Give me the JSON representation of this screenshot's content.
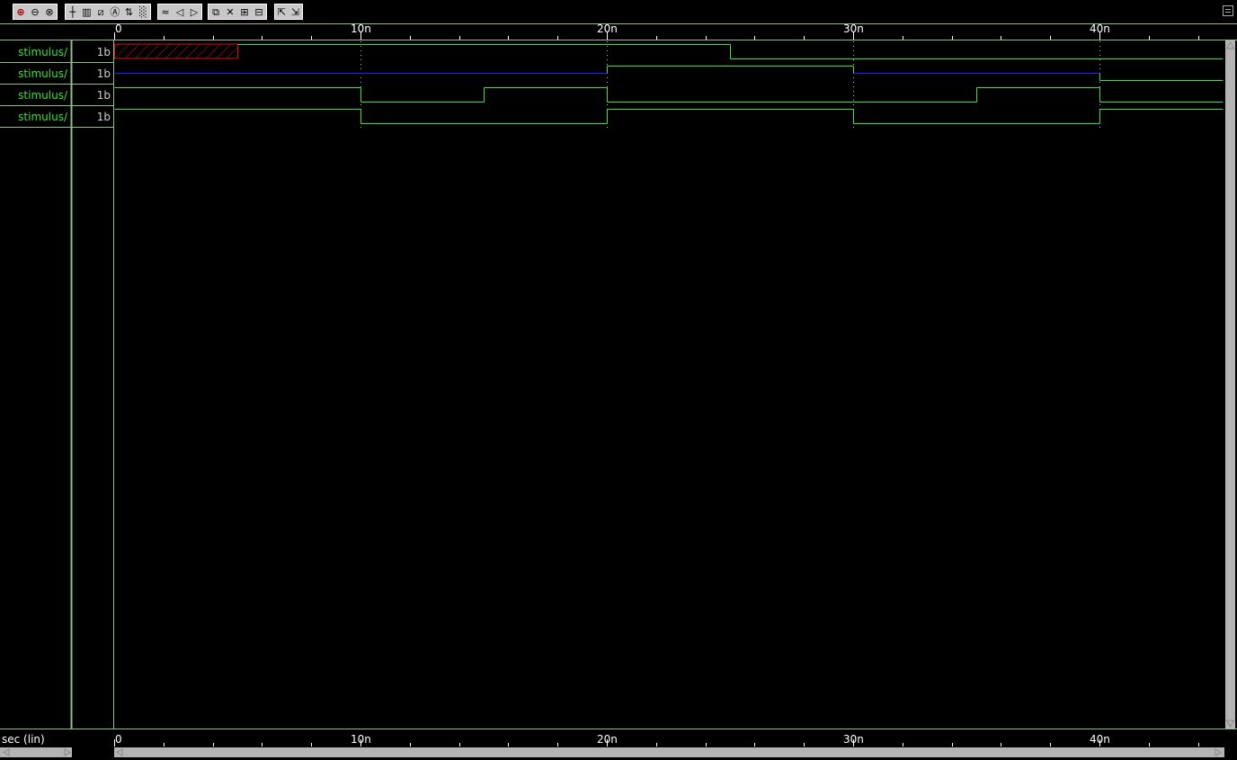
{
  "toolbar": {
    "groups": [
      {
        "name": "zoom",
        "icons": [
          "zoom-in-icon",
          "zoom-out-icon",
          "zoom-fit-icon"
        ]
      },
      {
        "name": "cursor",
        "icons": [
          "cursor-icon",
          "grid-lines-icon",
          "measure-icon",
          "annotate-icon",
          "marker-icon",
          "dots-grid-icon"
        ]
      },
      {
        "name": "navigate",
        "icons": [
          "wave-icon",
          "prev-edge-icon",
          "next-edge-icon"
        ]
      },
      {
        "name": "edit",
        "icons": [
          "copy-icon",
          "delete-icon",
          "group-icon",
          "ungroup-icon"
        ]
      },
      {
        "name": "view",
        "icons": [
          "expand-icon",
          "collapse-icon"
        ]
      }
    ]
  },
  "signals": [
    {
      "name": "stimulus/",
      "width": "1b"
    },
    {
      "name": "stimulus/",
      "width": "1b"
    },
    {
      "name": "stimulus/",
      "width": "1b"
    },
    {
      "name": "stimulus/",
      "width": "1b"
    }
  ],
  "timeline": {
    "unit_label": "sec (lin)",
    "top_ticks": [
      "0",
      "10n",
      "20n",
      "30n",
      "40n"
    ],
    "bottom_ticks": [
      "0",
      "10n",
      "20n",
      "30n",
      "40n"
    ]
  },
  "waveforms": [
    {
      "segments": [
        {
          "t0": 0,
          "t1": 5,
          "state": "X"
        },
        {
          "t0": 5,
          "t1": 25,
          "state": "1"
        },
        {
          "t0": 25,
          "t1": 45,
          "state": "0"
        }
      ]
    },
    {
      "segments": [
        {
          "t0": 0,
          "t1": 20,
          "state": "Z"
        },
        {
          "t0": 20,
          "t1": 30,
          "state": "1"
        },
        {
          "t0": 30,
          "t1": 40,
          "state": "Z"
        },
        {
          "t0": 40,
          "t1": 45,
          "state": "0"
        }
      ]
    },
    {
      "segments": [
        {
          "t0": 0,
          "t1": 10,
          "state": "1"
        },
        {
          "t0": 10,
          "t1": 15,
          "state": "0"
        },
        {
          "t0": 15,
          "t1": 20,
          "state": "1"
        },
        {
          "t0": 20,
          "t1": 35,
          "state": "0"
        },
        {
          "t0": 35,
          "t1": 40,
          "state": "1"
        },
        {
          "t0": 40,
          "t1": 45,
          "state": "0"
        }
      ]
    },
    {
      "segments": [
        {
          "t0": 0,
          "t1": 10,
          "state": "1"
        },
        {
          "t0": 10,
          "t1": 20,
          "state": "0"
        },
        {
          "t0": 20,
          "t1": 30,
          "state": "1"
        },
        {
          "t0": 30,
          "t1": 40,
          "state": "0"
        },
        {
          "t0": 40,
          "t1": 45,
          "state": "1"
        }
      ]
    }
  ],
  "time_range_ns": [
    0,
    45
  ],
  "colors": {
    "signal": "#35e235",
    "unknown": "#d01010",
    "highz": "#2020ff",
    "text": "#ffffff",
    "divider": "#8fbf8f"
  }
}
